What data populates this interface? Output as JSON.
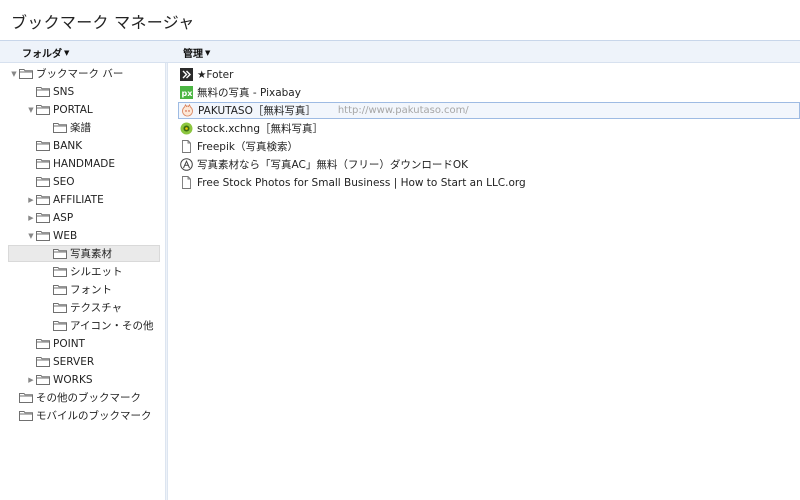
{
  "app": {
    "title": "ブックマーク マネージャ"
  },
  "toolbar": {
    "folders_label": "フォルダ",
    "manage_label": "管理"
  },
  "folders": [
    {
      "label": "ブックマーク バー",
      "depth": 0,
      "twisty": "open"
    },
    {
      "label": "SNS",
      "depth": 1,
      "twisty": "none"
    },
    {
      "label": "PORTAL",
      "depth": 1,
      "twisty": "open"
    },
    {
      "label": "楽譜",
      "depth": 2,
      "twisty": "none"
    },
    {
      "label": "BANK",
      "depth": 1,
      "twisty": "none"
    },
    {
      "label": "HANDMADE",
      "depth": 1,
      "twisty": "none"
    },
    {
      "label": "SEO",
      "depth": 1,
      "twisty": "none"
    },
    {
      "label": "AFFILIATE",
      "depth": 1,
      "twisty": "closed"
    },
    {
      "label": "ASP",
      "depth": 1,
      "twisty": "closed"
    },
    {
      "label": "WEB",
      "depth": 1,
      "twisty": "open"
    },
    {
      "label": "写真素材",
      "depth": 2,
      "twisty": "none",
      "selected": true
    },
    {
      "label": "シルエット",
      "depth": 2,
      "twisty": "none"
    },
    {
      "label": "フォント",
      "depth": 2,
      "twisty": "none"
    },
    {
      "label": "テクスチャ",
      "depth": 2,
      "twisty": "none"
    },
    {
      "label": "アイコン・その他",
      "depth": 2,
      "twisty": "none"
    },
    {
      "label": "POINT",
      "depth": 1,
      "twisty": "none"
    },
    {
      "label": "SERVER",
      "depth": 1,
      "twisty": "none"
    },
    {
      "label": "WORKS",
      "depth": 1,
      "twisty": "closed"
    },
    {
      "label": "その他のブックマーク",
      "depth": 0,
      "twisty": "none"
    },
    {
      "label": "モバイルのブックマーク",
      "depth": 0,
      "twisty": "none"
    }
  ],
  "bookmarks": [
    {
      "title": "★Foter",
      "url": "",
      "icon": "foter-icon"
    },
    {
      "title": "無料の写真 - Pixabay",
      "url": "",
      "icon": "pixabay-icon"
    },
    {
      "title": "PAKUTASO［無料写真］",
      "url": "http://www.pakutaso.com/",
      "icon": "pakutaso-icon",
      "selected": true
    },
    {
      "title": "stock.xchng［無料写真］",
      "url": "",
      "icon": "stockxchng-icon"
    },
    {
      "title": "Freepik（写真検索）",
      "url": "",
      "icon": "page-icon"
    },
    {
      "title": "写真素材なら「写真AC」無料（フリー）ダウンロードOK",
      "url": "",
      "icon": "photoac-icon"
    },
    {
      "title": "Free Stock Photos for Small Business | How to Start an LLC.org",
      "url": "",
      "icon": "page-icon"
    }
  ],
  "colors": {
    "toolbar_bg": "#eef3fa",
    "selected_border": "#9ebbe3",
    "pixabay_green": "#4bb543",
    "stockxchng_green": "#8cc63f"
  }
}
